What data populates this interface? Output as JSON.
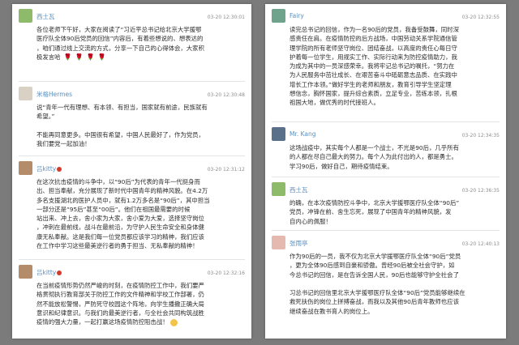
{
  "left_panel": {
    "comments": [
      {
        "user": "西土瓦",
        "time": "03-20 12:30:01",
        "avatar_color": "#8dbb6a",
        "lines": [
          "各位老师下午好，大家在阅读了“习近平总书记给北京大学援鄂",
          "医疗队全体90后党员的回信”内容后，有着些想说的、想表达的",
          "，咱们通过线上交流的方式，分享一下自己的心得体会，大家积",
          "极发言哈"
        ],
        "flowers": [
          "🌹",
          "🌹",
          "🌹",
          "🌹"
        ]
      },
      {
        "user": "米格Hermes",
        "time": "03-20 12:30:48",
        "avatar_color": "#d9d1c4",
        "lines": [
          "说“青年一代有理想、有本领、有担当，国家就有前途，民族就有",
          "希望。”",
          "",
          "不能再同意更多。中国很有希望，中国人民最好了，作为党员，",
          "我们要党一起加油！"
        ]
      },
      {
        "user": "吕kitty",
        "time": "03-20 12:31:12",
        "avatar_color": "#b58c6a",
        "lines": [
          "在这次抗击疫情的斗争中，以“90后”为代表的青年一代挺身而",
          "出、担当奉献，充分展现了新时代中国青年的精神风貌。在4.2万",
          "多名支援湖北的医护人员中，就有1.2万多名是“90后”，其中担当",
          "一部分还是“95后”甚至“00后”。他们在祖国最需要的时候",
          "站出来、冲上去，舍小家为大家，舍小爱为大爱，选择坚守岗位",
          "，冲刺在最前线，战斗在最前沿，为守护人民生命安全和身体健",
          "康无私奉献。这是我们每一位党员都应该学习的精神，我们应该",
          "在工作中学习这些最美逆行者的勇于担当、无私奉献的精神！"
        ]
      },
      {
        "user": "吕kitty",
        "time": "03-20 12:32:16",
        "avatar_color": "#b58c6a",
        "lines": [
          "在当前疫情形势仍然严峻的时刻，在疫情防控工作中，我们要严",
          "格贯彻执行教育部关于防控工作的文件精神和学校工作部署，仍",
          "然不能放松警惕，严防死守校园这个阵地，向学生播撒正确大局",
          "意识和纪律意识。与我们的最美逆行者，与全社会共同构筑战胜",
          "疫情的强大力量，一起打赢这场疫情防控阻击战！"
        ]
      }
    ]
  },
  "right_panel": {
    "comments": [
      {
        "user": "Fairy",
        "time": "03-20 12:32:55",
        "avatar_color": "#6fa38c",
        "lines": [
          "读完总书记的回信，作为一名90后的党员，我备受鼓舞，同时深",
          "感责任在肩。在疫情防控的后方战场，中国劳动关系学院通信管",
          "理学院的所有老师坚守岗位、团结奋战，以高度的责任心每日守",
          "护着每一位学生，用规实工作、实际行动来为防控疫情助力，我",
          "为成为其中的一员深感荣幸。我将牢记总书记的嘱托，“努力在",
          "为人民服务中茁壮成长、在艰苦奋斗中砥砺意志品质、在实践中",
          "增长工作本领。”做好学生的老师和朋友，教育引导学生坚定理",
          "想信念，胸怀国家，提升综合素质，立足专业，苦练本领，扎根",
          "祖国大地，做优秀的时代接班人。"
        ]
      },
      {
        "user": "Mr. Kang",
        "time": "03-20 12:34:35",
        "avatar_color": "#5a6f8a",
        "lines": [
          "这场战疫中，其实每个人都是一个战士，不光是90后，几乎所有",
          "的人都在尽自己最大的努力。每个人为此付出的人，都是勇士。",
          "学习90后，做好自己，期待疫情结束。"
        ]
      },
      {
        "user": "西土瓦",
        "time": "03-20 12:36:35",
        "avatar_color": "#8dbb6a",
        "lines": [
          "的确，在本次疫情防控斗争中，北京大学援鄂医疗队全体“90后”",
          "党员，冲锋在前、舍生忘死，展现了中国青年的精神风貌，发",
          "自内心的佩服！"
        ]
      },
      {
        "user": "张雨亭",
        "time": "03-20 12:40:13",
        "avatar_color": "#e6b9b0",
        "lines": [
          "作为90后的一员，我不仅为北京大学援鄂医疗队全体“90后”党员",
          "，更为全体90后感到自豪和骄傲。曾经90后被全社会守护，如",
          "今总书记的回信，是在告诉全国人民，90后也能够守护全社会了",
          "",
          "习总书记的回信里北京大学援鄂医疗队全体“90后”党员能够继续在",
          "救死扶伤的岗位上拼搏奋战，而我以及其他90后青年教师也应该",
          "继续奋战在教书育人的岗位上。"
        ]
      }
    ]
  }
}
